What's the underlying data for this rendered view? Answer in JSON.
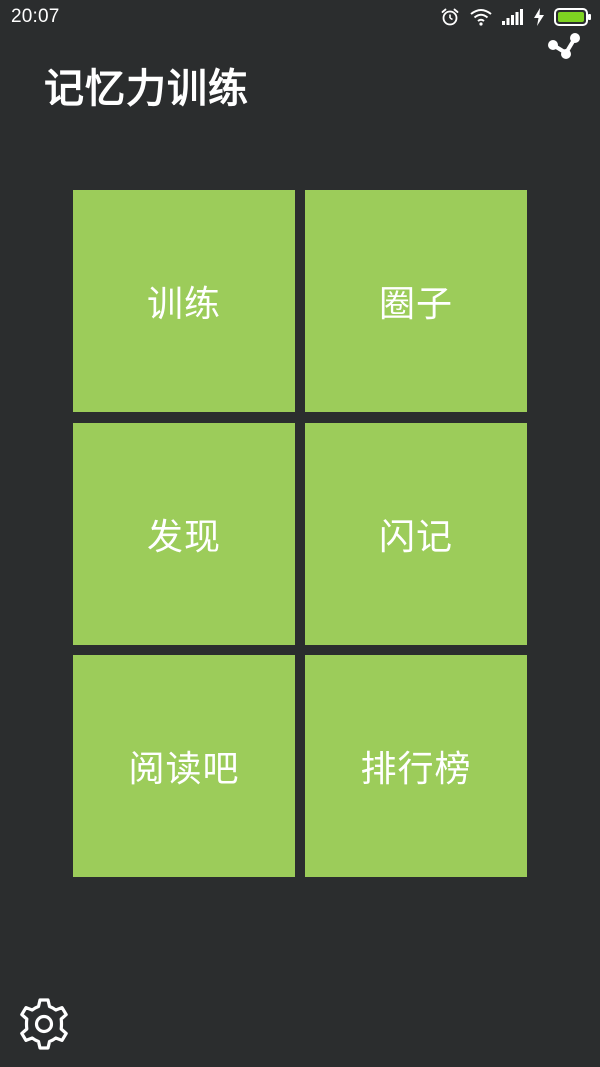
{
  "status_bar": {
    "time": "20:07",
    "icons": [
      "alarm-icon",
      "wifi-icon",
      "signal-icon",
      "charging-icon",
      "battery-icon"
    ],
    "battery_color": "#7ed321"
  },
  "header": {
    "title": "记忆力训练",
    "share_icon": "share-icon"
  },
  "menu": {
    "tile_color": "#9ccc5a",
    "tiles": [
      {
        "label": "训练"
      },
      {
        "label": "圈子"
      },
      {
        "label": "发现"
      },
      {
        "label": "闪记"
      },
      {
        "label": "阅读吧"
      },
      {
        "label": "排行榜"
      }
    ]
  },
  "footer": {
    "settings_icon": "gear-icon"
  }
}
